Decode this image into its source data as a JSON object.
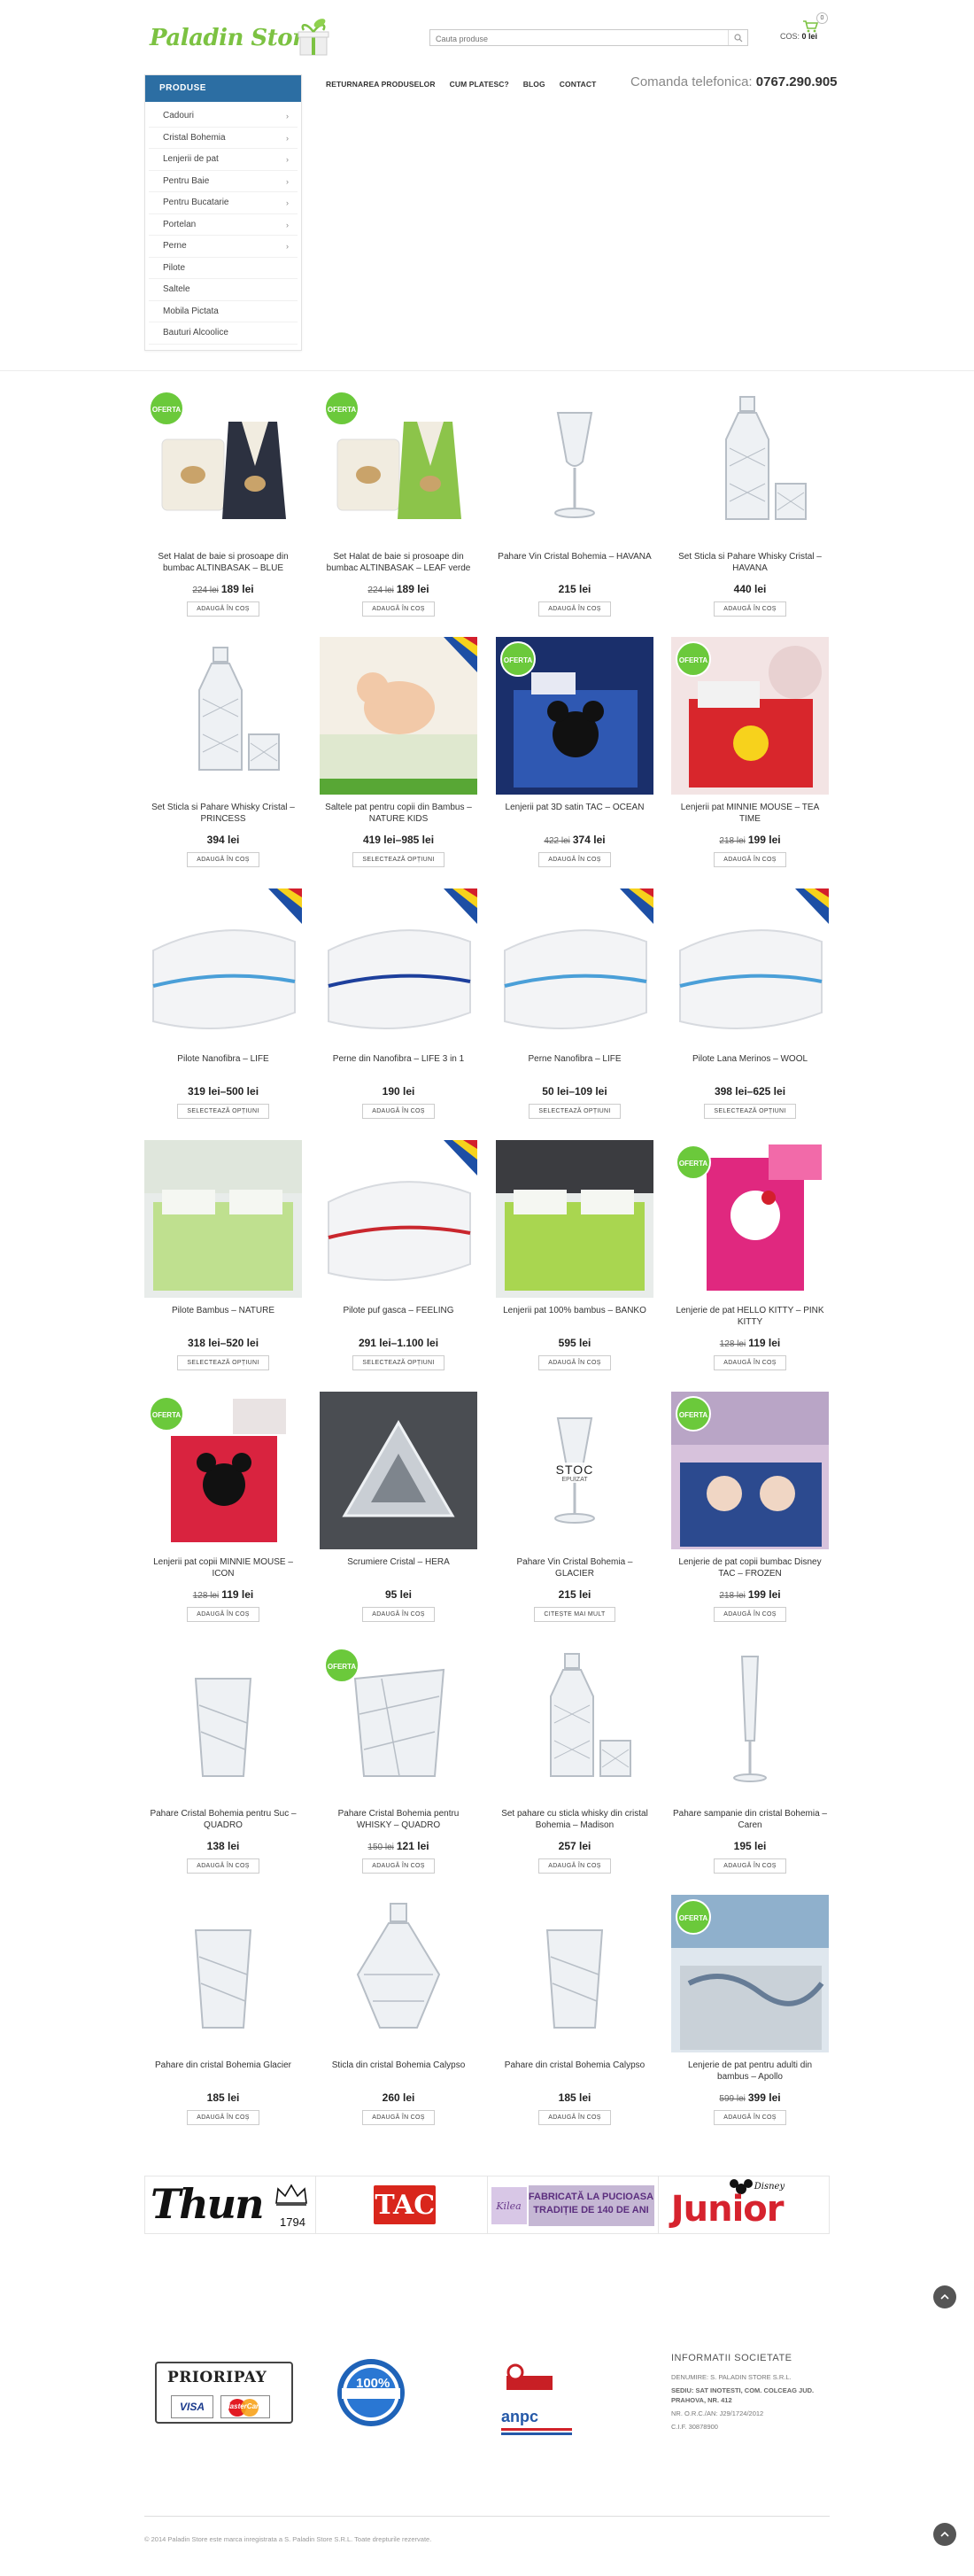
{
  "header": {
    "logo_text": "Paladin Store",
    "search_placeholder": "Cauta produse",
    "cart_label": "COS:",
    "cart_total": "0 lei",
    "cart_count": "0"
  },
  "sidebar": {
    "title": "PRODUSE",
    "items": [
      {
        "label": "Cadouri",
        "has_children": true
      },
      {
        "label": "Cristal Bohemia",
        "has_children": true
      },
      {
        "label": "Lenjerii de pat",
        "has_children": true
      },
      {
        "label": "Pentru Baie",
        "has_children": true
      },
      {
        "label": "Pentru Bucatarie",
        "has_children": true
      },
      {
        "label": "Portelan",
        "has_children": true
      },
      {
        "label": "Perne",
        "has_children": true
      },
      {
        "label": "Pilote",
        "has_children": false
      },
      {
        "label": "Saltele",
        "has_children": false
      },
      {
        "label": "Mobila Pictata",
        "has_children": false
      },
      {
        "label": "Bauturi Alcoolice",
        "has_children": false
      }
    ]
  },
  "nav": {
    "items": [
      "RETURNAREA PRODUSELOR",
      "CUM PLATESC?",
      "BLOG",
      "CONTACT"
    ]
  },
  "phone": {
    "label": "Comanda telefonica:",
    "number": "0767.290.905"
  },
  "offer_label": "OFERTA",
  "products": [
    {
      "name": "Set Halat de baie si prosoape din bumbac ALTINBASAK – BLUE",
      "old_price": "224 lei",
      "price": "189 lei",
      "button": "ADAUGĂ ÎN COȘ",
      "offer": true,
      "img": "robe-blue"
    },
    {
      "name": "Set Halat de baie si prosoape din bumbac ALTINBASAK – LEAF verde",
      "old_price": "224 lei",
      "price": "189 lei",
      "button": "ADAUGĂ ÎN COȘ",
      "offer": true,
      "img": "robe-green"
    },
    {
      "name": "Pahare Vin Cristal Bohemia – HAVANA",
      "old_price": "",
      "price": "215 lei",
      "button": "ADAUGĂ ÎN COȘ",
      "offer": false,
      "img": "wineglass"
    },
    {
      "name": "Set Sticla si Pahare Whisky Cristal – HAVANA",
      "old_price": "",
      "price": "440 lei",
      "button": "ADAUGĂ ÎN COȘ",
      "offer": false,
      "img": "decanter"
    },
    {
      "name": "Set Sticla si Pahare Whisky Cristal – PRINCESS",
      "old_price": "",
      "price": "394 lei",
      "button": "ADAUGĂ ÎN COȘ",
      "offer": false,
      "img": "decanter2"
    },
    {
      "name": "Saltele pat pentru copii din Bambus – NATURE KIDS",
      "old_price": "",
      "price": "419 lei–985 lei",
      "button": "SELECTEAZĂ OPȚIUNI",
      "offer": false,
      "img": "baby"
    },
    {
      "name": "Lenjerii pat 3D satin TAC – OCEAN",
      "old_price": "422 lei",
      "price": "374 lei",
      "button": "ADAUGĂ ÎN COȘ",
      "offer": true,
      "img": "bed-blue"
    },
    {
      "name": "Lenjerii pat MINNIE MOUSE – TEA TIME",
      "old_price": "218 lei",
      "price": "199 lei",
      "button": "ADAUGĂ ÎN COȘ",
      "offer": true,
      "img": "bed-red"
    },
    {
      "name": "Pilote Nanofibra – LIFE",
      "old_price": "",
      "price": "319 lei–500 lei",
      "button": "SELECTEAZĂ OPȚIUNI",
      "offer": false,
      "img": "quilt"
    },
    {
      "name": "Perne din Nanofibra – LIFE 3 in 1",
      "old_price": "",
      "price": "190 lei",
      "button": "ADAUGĂ ÎN COȘ",
      "offer": false,
      "img": "pillow-blue"
    },
    {
      "name": "Perne Nanofibra – LIFE",
      "old_price": "",
      "price": "50 lei–109 lei",
      "button": "SELECTEAZĂ OPȚIUNI",
      "offer": false,
      "img": "pillows"
    },
    {
      "name": "Pilote Lana Merinos – WOOL",
      "old_price": "",
      "price": "398 lei–625 lei",
      "button": "SELECTEAZĂ OPȚIUNI",
      "offer": false,
      "img": "quilt2"
    },
    {
      "name": "Pilote Bambus – NATURE",
      "old_price": "",
      "price": "318 lei–520 lei",
      "button": "SELECTEAZĂ OPȚIUNI",
      "offer": false,
      "img": "bed-green"
    },
    {
      "name": "Pilote puf gasca – FEELING",
      "old_price": "",
      "price": "291 lei–1.100 lei",
      "button": "SELECTEAZĂ OPȚIUNI",
      "offer": false,
      "img": "quilt-red"
    },
    {
      "name": "Lenjerii pat 100% bambus – BANKO",
      "old_price": "",
      "price": "595 lei",
      "button": "ADAUGĂ ÎN COȘ",
      "offer": false,
      "img": "bed-lime"
    },
    {
      "name": "Lenjerie de pat HELLO KITTY – PINK KITTY",
      "old_price": "128 lei",
      "price": "119 lei",
      "button": "ADAUGĂ ÎN COȘ",
      "offer": true,
      "img": "kitty"
    },
    {
      "name": "Lenjerii pat copii MINNIE MOUSE – ICON",
      "old_price": "128 lei",
      "price": "119 lei",
      "button": "ADAUGĂ ÎN COȘ",
      "offer": true,
      "img": "minnie"
    },
    {
      "name": "Scrumiere Cristal – HERA",
      "old_price": "",
      "price": "95 lei",
      "button": "ADAUGĂ ÎN COȘ",
      "offer": false,
      "img": "ashtray"
    },
    {
      "name": "Pahare Vin Cristal Bohemia – GLACIER",
      "old_price": "",
      "price": "215 lei",
      "button": "CITEȘTE MAI MULT",
      "offer": false,
      "img": "glacier",
      "overlay": "STOC",
      "overlay_sub": "EPUIZAT"
    },
    {
      "name": "Lenjerie de pat copii bumbac Disney TAC – FROZEN",
      "old_price": "218 lei",
      "price": "199 lei",
      "button": "ADAUGĂ ÎN COȘ",
      "offer": true,
      "img": "frozen"
    },
    {
      "name": "Pahare Cristal Bohemia pentru Suc – QUADRO",
      "old_price": "",
      "price": "138 lei",
      "button": "ADAUGĂ ÎN COȘ",
      "offer": false,
      "img": "tumbler"
    },
    {
      "name": "Pahare Cristal Bohemia pentru WHISKY – QUADRO",
      "old_price": "150 lei",
      "price": "121 lei",
      "button": "ADAUGĂ ÎN COȘ",
      "offer": true,
      "img": "whisky"
    },
    {
      "name": "Set pahare cu sticla whisky din cristal Bohemia – Madison",
      "old_price": "",
      "price": "257 lei",
      "button": "ADAUGĂ ÎN COȘ",
      "offer": false,
      "img": "madison"
    },
    {
      "name": "Pahare sampanie din cristal Bohemia – Caren",
      "old_price": "",
      "price": "195 lei",
      "button": "ADAUGĂ ÎN COȘ",
      "offer": false,
      "img": "flute"
    },
    {
      "name": "Pahare din cristal Bohemia Glacier",
      "old_price": "",
      "price": "185 lei",
      "button": "ADAUGĂ ÎN COȘ",
      "offer": false,
      "img": "glacier-tumbler"
    },
    {
      "name": "Sticla din cristal Bohemia Calypso",
      "old_price": "",
      "price": "260 lei",
      "button": "ADAUGĂ ÎN COȘ",
      "offer": false,
      "img": "calypso"
    },
    {
      "name": "Pahare din cristal Bohemia Calypso",
      "old_price": "",
      "price": "185 lei",
      "button": "ADAUGĂ ÎN COȘ",
      "offer": false,
      "img": "calypso-glass"
    },
    {
      "name": "Lenjerie de pat pentru adulti din bambus – Apollo",
      "old_price": "599 lei",
      "price": "399 lei",
      "button": "ADAUGĂ ÎN COȘ",
      "offer": true,
      "img": "apollo"
    }
  ],
  "brands": {
    "thun": "Thun",
    "thun_year": "1794",
    "tac": "TAC",
    "kilea_line1": "FABRICATĂ LA PUCIOASA",
    "kilea_line2": "TRADIȚIE DE 140 DE ANI",
    "kilea_logo": "Kilea",
    "junior": "Junior",
    "disney": "Disney"
  },
  "footer": {
    "payu": "PRIORIPAY",
    "visa": "VISA",
    "mastercard": "MasterCard",
    "secure": "100%",
    "anpc": "anpc",
    "info_title": "INFORMATII SOCIETATE",
    "info_lines": [
      "DENUMIRE: S. PALADIN STORE S.R.L.",
      "SEDIU: SAT INOTESTI, COM. COLCEAG JUD. PRAHOVA, NR. 412",
      "NR. O.R.C./AN: J29/1724/2012",
      "C.I.F. 30878900"
    ],
    "copyright": "© 2014 Paladin Store este marca inregistrata a S. Paladin Store S.R.L. Toate drepturile rezervate."
  },
  "colors": {
    "accent": "#2c6ea3",
    "offer": "#6bc93b",
    "logo": "#7cc242"
  }
}
